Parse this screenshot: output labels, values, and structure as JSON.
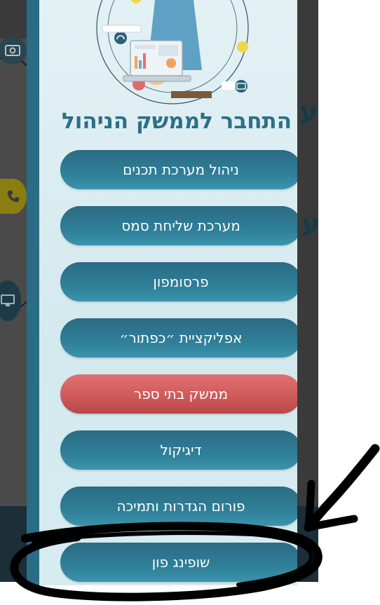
{
  "modal": {
    "title": "התחבר לממשק הניהול",
    "buttons": [
      {
        "label": "ניהול מערכת תכנים",
        "style": "primary"
      },
      {
        "label": "מערכת שליחת סמס",
        "style": "primary"
      },
      {
        "label": "פרסומפון",
        "style": "primary"
      },
      {
        "label": "אפליקציית ״כפתור״",
        "style": "primary"
      },
      {
        "label": "ממשק בתי ספר",
        "style": "danger"
      },
      {
        "label": "דיגיקול",
        "style": "primary"
      },
      {
        "label": "פורום הגדרות ותמיכה",
        "style": "primary"
      },
      {
        "label": "שופינג פון",
        "style": "primary"
      }
    ]
  },
  "background": {
    "heading_1": "ע",
    "heading_2": "ע"
  },
  "colors": {
    "primary": "#2f7f98",
    "danger": "#cd5858",
    "title": "#2d6f86",
    "modal_border": "#2a6c86"
  },
  "icons": [
    "money-icon",
    "phone-icon",
    "monitor-icon",
    "headset-icon",
    "laptop-icon"
  ]
}
